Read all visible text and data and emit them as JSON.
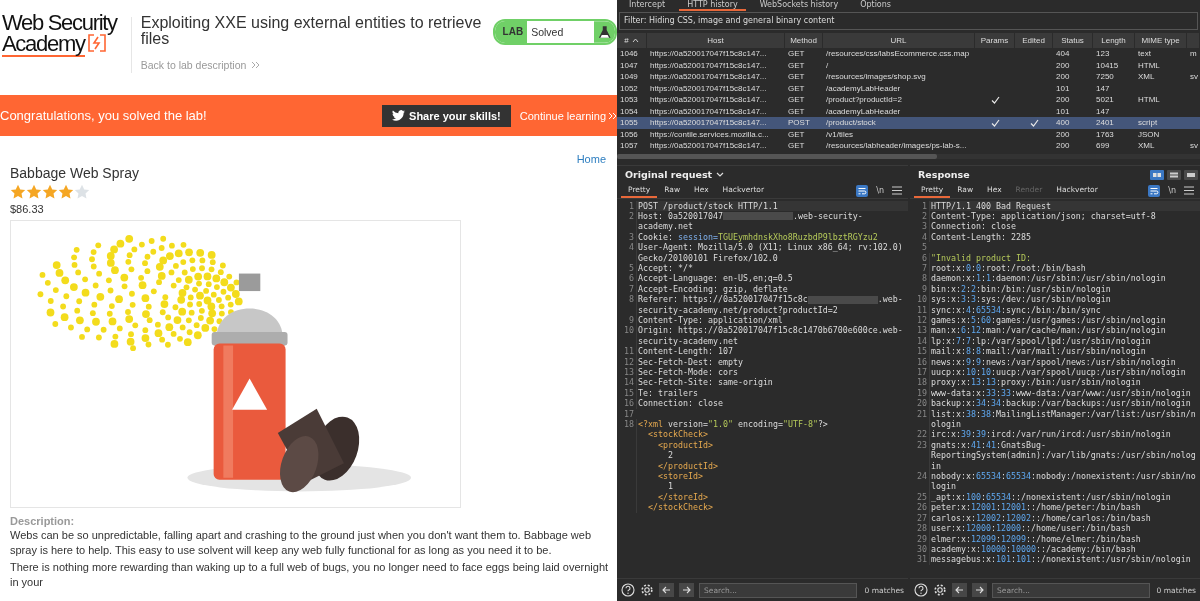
{
  "browser": {
    "logo": {
      "lines": [
        "Web Security",
        "Academy"
      ]
    },
    "lab_title": "Exploiting XXE using external entities to retrieve files",
    "back_link": "Back to lab description",
    "lab_status": {
      "label": "LAB",
      "status": "Solved"
    },
    "banner": {
      "message": "Congratulations, you solved the lab!",
      "share_button": "Share your skills!",
      "continue_link": "Continue learning"
    },
    "home_link": "Home",
    "product": {
      "name": "Babbage Web Spray",
      "stars": 4,
      "price": "$86.33",
      "description_label": "Description:",
      "paragraphs": [
        "Webs can be so unpredictable, falling apart and crashing to the ground just when you don't want them to. Babbage web spray is here to help. This easy to use solvent will keep any web fully functional for as long as you need it to be.",
        "There is nothing more rewarding than waking up to a full web of bugs, you no longer need to face eggs being laid overnight in your"
      ]
    }
  },
  "proxy": {
    "tabs": [
      {
        "label": "Intercept",
        "selected": false
      },
      {
        "label": "HTTP history",
        "selected": true
      },
      {
        "label": "WebSockets history",
        "selected": false
      },
      {
        "label": "Options",
        "selected": false
      }
    ],
    "filter": "Filter: Hiding CSS, image and general binary content",
    "table": {
      "columns": [
        "#",
        "Host",
        "Method",
        "URL",
        "Params",
        "Edited",
        "Status",
        "Length",
        "MIME type"
      ],
      "rows": [
        {
          "number": "1046",
          "host": "https://0a520017047f15c8c147...",
          "method": "GET",
          "url": "/resources/css/labsEcommerce.css.map",
          "params": false,
          "edited": false,
          "status": "404",
          "length": "123",
          "mime_type": "text",
          "column_10": "m",
          "selected": false
        },
        {
          "number": "1047",
          "host": "https://0a520017047f15c8c147...",
          "method": "GET",
          "url": "/",
          "params": false,
          "edited": false,
          "status": "200",
          "length": "10415",
          "mime_type": "HTML",
          "selected": false
        },
        {
          "number": "1049",
          "host": "https://0a520017047f15c8c147...",
          "method": "GET",
          "url": "/resources/images/shop.svg",
          "params": false,
          "edited": false,
          "status": "200",
          "length": "7250",
          "mime_type": "XML",
          "column_10": "sv",
          "selected": false
        },
        {
          "number": "1052",
          "host": "https://0a520017047f15c8c147...",
          "method": "GET",
          "url": "/academyLabHeader",
          "params": false,
          "edited": false,
          "status": "101",
          "length": "147",
          "selected": false
        },
        {
          "number": "1053",
          "host": "https://0a520017047f15c8c147...",
          "method": "GET",
          "url": "/product?productId=2",
          "params": true,
          "edited": false,
          "status": "200",
          "length": "5021",
          "mime_type": "HTML",
          "selected": false
        },
        {
          "number": "1054",
          "host": "https://0a520017047f15c8c147...",
          "method": "GET",
          "url": "/academyLabHeader",
          "params": false,
          "edited": false,
          "status": "101",
          "length": "147",
          "selected": false
        },
        {
          "number": "1055",
          "host": "https://0a520017047f15c8c147...",
          "method": "POST",
          "url": "/product/stock",
          "params": true,
          "edited": true,
          "status": "400",
          "length": "2401",
          "mime_type": "script",
          "selected": true
        },
        {
          "number": "1056",
          "host": "https://contile.services.mozilla.c...",
          "method": "GET",
          "url": "/v1/tiles",
          "params": false,
          "edited": false,
          "status": "200",
          "length": "1763",
          "mime_type": "JSON",
          "selected": false
        },
        {
          "number": "1057",
          "host": "https://0a520017047f15c8c147...",
          "method": "GET",
          "url": "/resources/labheader/images/ps-lab-s...",
          "params": false,
          "edited": false,
          "status": "200",
          "length": "699",
          "mime_type": "XML",
          "column_10": "sv",
          "selected": false
        }
      ]
    }
  },
  "panes": [
    {
      "kind": "request",
      "title": "Original request",
      "tabs": [
        {
          "label": "Pretty",
          "selected": true,
          "disabled": false
        },
        {
          "label": "Raw",
          "selected": false,
          "disabled": false
        },
        {
          "label": "Hex",
          "selected": false,
          "disabled": false
        },
        {
          "label": "Hackvertor",
          "selected": false,
          "disabled": false
        }
      ],
      "newline_toggle": "\\n",
      "lines": [
        {
          "number": "1",
          "text": "POST /product/stock HTTP/1.1"
        },
        {
          "number": "2",
          "parts": [
            "Host: 0a520017047",
            {
              "kind": "redacted"
            },
            ".web-security-academy.net"
          ]
        },
        {
          "number": "3",
          "parts": [
            "Cookie: ",
            {
              "kind": "key",
              "text": "session="
            },
            {
              "kind": "string",
              "text": "TGUEymhdnskXho8RuzbdP9lbztRGYzu2"
            }
          ]
        },
        {
          "number": "4",
          "text": "User-Agent: Mozilla/5.0 (X11; Linux x86_64; rv:102.0) Gecko/20100101 Firefox/102.0"
        },
        {
          "number": "5",
          "text": "Accept: */*"
        },
        {
          "number": "6",
          "text": "Accept-Language: en-US,en;q=0.5"
        },
        {
          "number": "7",
          "text": "Accept-Encoding: gzip, deflate"
        },
        {
          "number": "8",
          "parts": [
            "Referer: https://0a520017047f15c8c",
            {
              "kind": "redacted"
            },
            ".web-security-academy.net/product?productId=2"
          ]
        },
        {
          "number": "9",
          "text": "Content-Type: application/xml"
        },
        {
          "number": "10",
          "text": "Origin: https://0a520017047f15c8c1470b6700e600ce.web-security-academy.net"
        },
        {
          "number": "11",
          "text": "Content-Length: 107"
        },
        {
          "number": "12",
          "text": "Sec-Fetch-Dest: empty"
        },
        {
          "number": "13",
          "text": "Sec-Fetch-Mode: cors"
        },
        {
          "number": "14",
          "text": "Sec-Fetch-Site: same-origin"
        },
        {
          "number": "15",
          "text": "Te: trailers"
        },
        {
          "number": "16",
          "text": "Connection: close"
        },
        {
          "number": "17"
        },
        {
          "number": "18",
          "parts": [
            {
              "kind": "tag",
              "text": "<?xml "
            },
            "version=",
            {
              "kind": "string",
              "text": "\"1.0\" "
            },
            "encoding=",
            {
              "kind": "string",
              "text": "\"UTF-8\""
            },
            "?>\n  ",
            {
              "kind": "tag",
              "text": "<stockCheck>\n    <productId>\n"
            },
            "      2\n    ",
            {
              "kind": "tag",
              "text": "</productId>\n    <storeId>\n"
            },
            "      1\n    ",
            {
              "kind": "tag",
              "text": "</storeId>\n  </stockCheck>"
            }
          ]
        }
      ],
      "search": {
        "placeholder": "Search..."
      },
      "matches": "0 matches"
    },
    {
      "kind": "response",
      "title": "Response",
      "layout_buttons": [
        {
          "selected": true
        },
        {
          "selected": false
        },
        {
          "selected": false
        }
      ],
      "tabs": [
        {
          "label": "Pretty",
          "selected": true,
          "disabled": false
        },
        {
          "label": "Raw",
          "selected": false,
          "disabled": false
        },
        {
          "label": "Hex",
          "selected": false,
          "disabled": false
        },
        {
          "label": "Render",
          "selected": false,
          "disabled": true
        },
        {
          "label": "Hackvertor",
          "selected": false,
          "disabled": false
        }
      ],
      "newline_toggle": "\\n",
      "lines": [
        {
          "number": "1",
          "text": "HTTP/1.1 400 Bad Request"
        },
        {
          "number": "2",
          "text": "Content-Type: application/json; charset=utf-8"
        },
        {
          "number": "3",
          "text": "Connection: close"
        },
        {
          "number": "4",
          "text": "Content-Length: 2285"
        },
        {
          "number": "5"
        },
        {
          "number": "6",
          "parts": [
            {
              "kind": "string",
              "text": "\"Invalid product ID:"
            }
          ]
        },
        {
          "number": "7",
          "parts": [
            "root:x:",
            {
              "kind": "number",
              "text": "0"
            },
            ":",
            {
              "kind": "number",
              "text": "0"
            },
            ":root:/root:/bin/bash"
          ]
        },
        {
          "number": "8",
          "parts": [
            "daemon:x:",
            {
              "kind": "number",
              "text": "1"
            },
            ":",
            {
              "kind": "number",
              "text": "1"
            },
            ":daemon:/usr/sbin:/usr/sbin/nologin"
          ]
        },
        {
          "number": "9",
          "parts": [
            "bin:x:",
            {
              "kind": "number",
              "text": "2"
            },
            ":",
            {
              "kind": "number",
              "text": "2"
            },
            ":bin:/bin:/usr/sbin/nologin"
          ]
        },
        {
          "number": "10",
          "parts": [
            "sys:x:",
            {
              "kind": "number",
              "text": "3"
            },
            ":",
            {
              "kind": "number",
              "text": "3"
            },
            ":sys:/dev:/usr/sbin/nologin"
          ]
        },
        {
          "number": "11",
          "parts": [
            "sync:x:",
            {
              "kind": "number",
              "text": "4"
            },
            ":",
            {
              "kind": "number",
              "text": "65534"
            },
            ":sync:/bin:/bin/sync"
          ]
        },
        {
          "number": "12",
          "parts": [
            "games:x:",
            {
              "kind": "number",
              "text": "5"
            },
            ":",
            {
              "kind": "number",
              "text": "60"
            },
            ":games:/usr/games:/usr/sbin/nologin"
          ]
        },
        {
          "number": "13",
          "parts": [
            "man:x:",
            {
              "kind": "number",
              "text": "6"
            },
            ":",
            {
              "kind": "number",
              "text": "12"
            },
            ":man:/var/cache/man:/usr/sbin/nologin"
          ]
        },
        {
          "number": "14",
          "parts": [
            "lp:x:",
            {
              "kind": "number",
              "text": "7"
            },
            ":",
            {
              "kind": "number",
              "text": "7"
            },
            ":lp:/var/spool/lpd:/usr/sbin/nologin"
          ]
        },
        {
          "number": "15",
          "parts": [
            "mail:x:",
            {
              "kind": "number",
              "text": "8"
            },
            ":",
            {
              "kind": "number",
              "text": "8"
            },
            ":mail:/var/mail:/usr/sbin/nologin"
          ]
        },
        {
          "number": "16",
          "parts": [
            "news:x:",
            {
              "kind": "number",
              "text": "9"
            },
            ":",
            {
              "kind": "number",
              "text": "9"
            },
            ":news:/var/spool/news:/usr/sbin/nologin"
          ]
        },
        {
          "number": "17",
          "parts": [
            "uucp:x:",
            {
              "kind": "number",
              "text": "10"
            },
            ":",
            {
              "kind": "number",
              "text": "10"
            },
            ":uucp:/var/spool/uucp:/usr/sbin/nologin"
          ]
        },
        {
          "number": "18",
          "parts": [
            "proxy:x:",
            {
              "kind": "number",
              "text": "13"
            },
            ":",
            {
              "kind": "number",
              "text": "13"
            },
            ":proxy:/bin:/usr/sbin/nologin"
          ]
        },
        {
          "number": "19",
          "parts": [
            "www-data:x:",
            {
              "kind": "number",
              "text": "33"
            },
            ":",
            {
              "kind": "number",
              "text": "33"
            },
            ":www-data:/var/www:/usr/sbin/nologin"
          ]
        },
        {
          "number": "20",
          "parts": [
            "backup:x:",
            {
              "kind": "number",
              "text": "34"
            },
            ":",
            {
              "kind": "number",
              "text": "34"
            },
            ":backup:/var/backups:/usr/sbin/nologin"
          ]
        },
        {
          "number": "21",
          "parts": [
            "list:x:",
            {
              "kind": "number",
              "text": "38"
            },
            ":",
            {
              "kind": "number",
              "text": "38"
            },
            ":MailingListManager:/var/list:/usr/sbin/nologin"
          ]
        },
        {
          "number": "22",
          "parts": [
            "irc:x:",
            {
              "kind": "number",
              "text": "39"
            },
            ":",
            {
              "kind": "number",
              "text": "39"
            },
            ":ircd:/var/run/ircd:/usr/sbin/nologin"
          ]
        },
        {
          "number": "23",
          "parts": [
            "gnats:x:",
            {
              "kind": "number",
              "text": "41"
            },
            ":",
            {
              "kind": "number",
              "text": "41"
            },
            ":GnatsBug-ReportingSystem(admin):/var/lib/gnats:/usr/sbin/nologin"
          ]
        },
        {
          "number": "24",
          "parts": [
            "nobody:x:",
            {
              "kind": "number",
              "text": "65534"
            },
            ":",
            {
              "kind": "number",
              "text": "65534"
            },
            ":nobody:/nonexistent:/usr/sbin/nologin"
          ]
        },
        {
          "number": "25",
          "parts": [
            "_apt:x:",
            {
              "kind": "number",
              "text": "100"
            },
            ":",
            {
              "kind": "number",
              "text": "65534"
            },
            "::/nonexistent:/usr/sbin/nologin"
          ]
        },
        {
          "number": "26",
          "parts": [
            "peter:x:",
            {
              "kind": "number",
              "text": "12001"
            },
            ":",
            {
              "kind": "number",
              "text": "12001"
            },
            "::/home/peter:/bin/bash"
          ]
        },
        {
          "number": "27",
          "parts": [
            "carlos:x:",
            {
              "kind": "number",
              "text": "12002"
            },
            ":",
            {
              "kind": "number",
              "text": "12002"
            },
            "::/home/carlos:/bin/bash"
          ]
        },
        {
          "number": "28",
          "parts": [
            "user:x:",
            {
              "kind": "number",
              "text": "12000"
            },
            ":",
            {
              "kind": "number",
              "text": "12000"
            },
            "::/home/user:/bin/bash"
          ]
        },
        {
          "number": "29",
          "parts": [
            "elmer:x:",
            {
              "kind": "number",
              "text": "12099"
            },
            ":",
            {
              "kind": "number",
              "text": "12099"
            },
            "::/home/elmer:/bin/bash"
          ]
        },
        {
          "number": "30",
          "parts": [
            "academy:x:",
            {
              "kind": "number",
              "text": "10000"
            },
            ":",
            {
              "kind": "number",
              "text": "10000"
            },
            "::/academy:/bin/bash"
          ]
        },
        {
          "number": "31",
          "parts": [
            "messagebus:x:",
            {
              "kind": "number",
              "text": "101"
            },
            ":",
            {
              "kind": "number",
              "text": "101"
            },
            "::/nonexistent:/usr/sbin/nologin"
          ]
        }
      ],
      "search": {
        "placeholder": "Search..."
      },
      "matches": "0 matches"
    }
  ]
}
